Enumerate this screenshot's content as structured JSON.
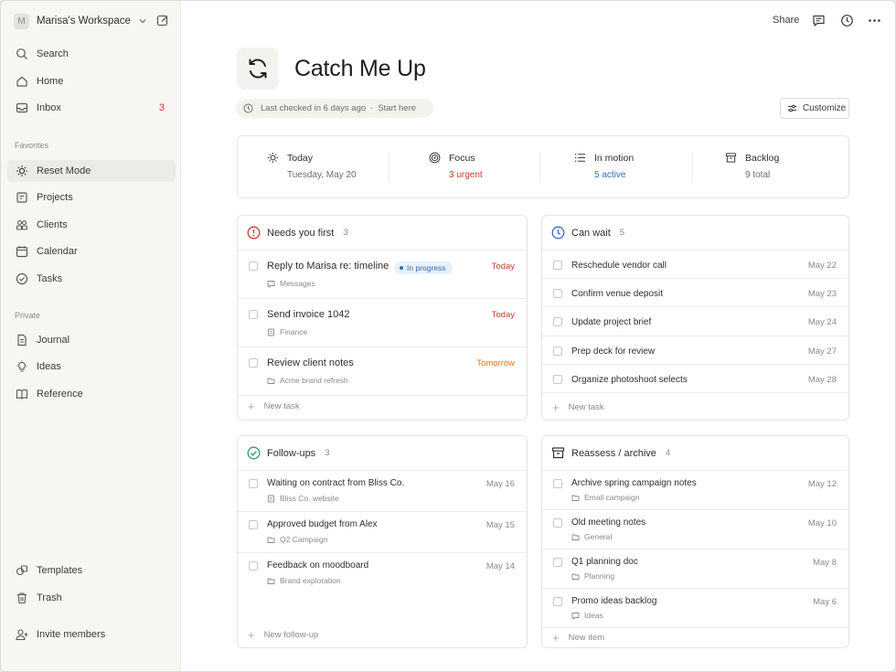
{
  "workspace": {
    "initial": "M",
    "name": "Marisa's Workspace"
  },
  "sidebar": {
    "top": [
      {
        "label": "Search"
      },
      {
        "label": "Home"
      },
      {
        "label": "Inbox",
        "badge": "3"
      }
    ],
    "favorites_label": "Favorites",
    "favorites": [
      {
        "label": "Reset Mode",
        "active": true
      },
      {
        "label": "Projects"
      },
      {
        "label": "Clients"
      },
      {
        "label": "Calendar"
      },
      {
        "label": "Tasks"
      }
    ],
    "private_label": "Private",
    "private": [
      {
        "label": "Journal"
      },
      {
        "label": "Ideas"
      },
      {
        "label": "Reference"
      }
    ],
    "bottom": [
      {
        "label": "Templates"
      },
      {
        "label": "Trash"
      },
      {
        "label": "Invite members"
      }
    ]
  },
  "topbar": {
    "share_label": "Share"
  },
  "page": {
    "title": "Catch Me Up",
    "meta_checked": "Last checked in 6 days ago",
    "meta_dot": "·",
    "meta_link": "Start here",
    "customize_label": "Customize"
  },
  "stats": [
    {
      "title": "Today",
      "value": "Tuesday, May 20",
      "icon": "sun-icon"
    },
    {
      "title": "Focus",
      "value": "3 urgent",
      "icon": "target-icon",
      "color": "#c53b34"
    },
    {
      "title": "In motion",
      "value": "5 active",
      "icon": "list-icon",
      "color": "#2f6fb8"
    },
    {
      "title": "Backlog",
      "value": "9 total",
      "icon": "archive-icon"
    }
  ],
  "cards": {
    "needs_first": {
      "title": "Needs you first",
      "count": "3",
      "items": [
        {
          "title": "Reply to Marisa re: timeline",
          "status": "In progress",
          "sub": "Messages",
          "due": "Today"
        },
        {
          "title": "Send invoice 1042",
          "sub": "Finance",
          "due": "Today"
        },
        {
          "title": "Review client notes",
          "sub": "Acme brand refresh",
          "due": "Tomorrow"
        }
      ],
      "add_label": "New task"
    },
    "can_wait": {
      "title": "Can wait",
      "count": "5",
      "items": [
        {
          "title": "Reschedule vendor call",
          "due": "May 22"
        },
        {
          "title": "Confirm venue deposit",
          "due": "May 23"
        },
        {
          "title": "Update project brief",
          "due": "May 24"
        },
        {
          "title": "Prep deck for review",
          "due": "May 27"
        },
        {
          "title": "Organize photoshoot selects",
          "due": "May 28"
        }
      ],
      "add_label": "New task"
    },
    "follow_ups": {
      "title": "Follow-ups",
      "count": "3",
      "items": [
        {
          "title": "Waiting on contract from Bliss Co.",
          "sub": "Bliss Co. website",
          "due": "May 16"
        },
        {
          "title": "Approved budget from Alex",
          "sub": "Q2 Campaign",
          "due": "May 15"
        },
        {
          "title": "Feedback on moodboard",
          "sub": "Brand exploration",
          "due": "May 14"
        }
      ],
      "add_label": "New follow-up"
    },
    "reassess": {
      "title": "Reassess / archive",
      "count": "4",
      "items": [
        {
          "title": "Archive spring campaign notes",
          "sub": "Email campaign",
          "due": "May 12"
        },
        {
          "title": "Old meeting notes",
          "sub": "General",
          "due": "May 10"
        },
        {
          "title": "Q1 planning doc",
          "sub": "Planning",
          "due": "May 8"
        },
        {
          "title": "Promo ideas backlog",
          "sub": "Ideas",
          "due": "May 6"
        }
      ],
      "add_label": "New item"
    }
  },
  "colors": {
    "urgent": "#c53b34",
    "active": "#2f6fb8",
    "tomorrow": "#d9751f",
    "success": "#2e9e6a"
  }
}
